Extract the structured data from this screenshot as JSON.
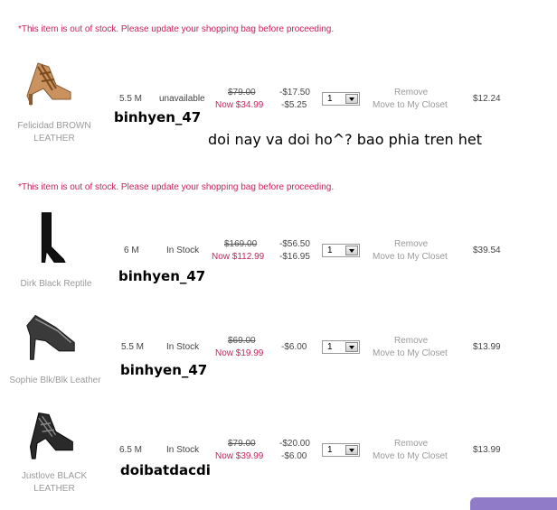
{
  "warning_text": "*This item is out of stock. Please update your shopping bag before proceeding.",
  "actions": {
    "remove": "Remove",
    "move": "Move to My Closet"
  },
  "note": "doi nay va doi ho^? bao phia tren het",
  "items": [
    {
      "name": "Felicidad BROWN LEATHER",
      "size": "5.5 M",
      "stock": "unavailable",
      "old_price": "$79.00",
      "now_price": "Now $34.99",
      "discounts": [
        "-$17.50",
        "-$5.25"
      ],
      "qty": "1",
      "total": "$12.24",
      "handwritten": "binhyen_47"
    },
    {
      "name": "Dirk Black Reptile",
      "size": "6 M",
      "stock": "In Stock",
      "old_price": "$169.00",
      "now_price": "Now $112.99",
      "discounts": [
        "-$56.50",
        "-$16.95"
      ],
      "qty": "1",
      "total": "$39.54",
      "handwritten": "binhyen_47"
    },
    {
      "name": "Sophie Blk/Blk Leather",
      "size": "5.5 M",
      "stock": "In Stock",
      "old_price": "$69.00",
      "now_price": "Now $19.99",
      "discounts": [
        "-$6.00"
      ],
      "qty": "1",
      "total": "$13.99",
      "handwritten": "binhyen_47"
    },
    {
      "name": "Justlove BLACK LEATHER",
      "size": "6.5 M",
      "stock": "In Stock",
      "old_price": "$79.00",
      "now_price": "Now $39.99",
      "discounts": [
        "-$20.00",
        "-$6.00"
      ],
      "qty": "1",
      "total": "$13.99",
      "handwritten": "doibatdacdi"
    }
  ]
}
